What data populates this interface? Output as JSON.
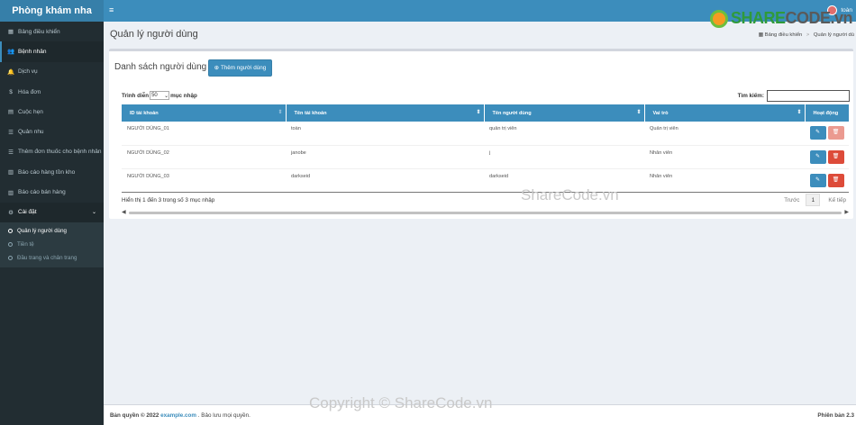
{
  "app": {
    "title": "Phòng khám nha"
  },
  "header": {
    "menu_icon": "hamburger-icon",
    "user_name": "toàn"
  },
  "sidebar": {
    "items": [
      {
        "label": "Bảng điều khiển",
        "icon": "dashboard-icon",
        "glyph": "▦"
      },
      {
        "label": "Bệnh nhân",
        "icon": "users-icon",
        "glyph": "👥"
      },
      {
        "label": "Dịch vụ",
        "icon": "bell-icon",
        "glyph": "🔔"
      },
      {
        "label": "Hóa đơn",
        "icon": "dollar-icon",
        "glyph": "$"
      },
      {
        "label": "Cuộc hẹn",
        "icon": "calendar-icon",
        "glyph": "▤"
      },
      {
        "label": "Quản nhu",
        "icon": "list-icon",
        "glyph": "☰"
      },
      {
        "label": "Thêm đơn thuốc cho bệnh nhân",
        "icon": "list-icon",
        "glyph": "☰"
      },
      {
        "label": "Báo cáo hàng tồn kho",
        "icon": "bar-chart-icon",
        "glyph": "▥"
      },
      {
        "label": "Báo cáo bán hàng",
        "icon": "bar-chart-icon",
        "glyph": "▥"
      }
    ],
    "settings": {
      "label": "Cài đặt",
      "icon": "gear-icon",
      "glyph": "⚙"
    },
    "subitems": [
      {
        "label": "Quản lý người dùng"
      },
      {
        "label": "Tiền tệ"
      },
      {
        "label": "Đầu trang và chân trang"
      }
    ]
  },
  "page": {
    "title": "Quản lý người dùng"
  },
  "breadcrumb": {
    "home": "Bảng điều khiển",
    "current": "Quản lý người dù"
  },
  "box": {
    "title": "Danh sách người dùng",
    "add_button": "Thêm người dùng"
  },
  "table_controls": {
    "show_label": "Trình diễn",
    "entries_value": "50",
    "entries_label": "mục nhập",
    "search_label": "Tìm kiếm:"
  },
  "table": {
    "columns": [
      "ID tài khoản",
      "Tên tài khoản",
      "Tên người dùng",
      "Vai trò",
      "Hoạt động"
    ],
    "rows": [
      [
        "NGƯỜI DÙNG_01",
        "toàn",
        "quản trị viên",
        "Quản trị viên"
      ],
      [
        "NGƯỜI DÙNG_02",
        "janobe",
        "j",
        "Nhân viên"
      ],
      [
        "NGƯỜI DÙNG_03",
        "darkseid",
        "darkseid",
        "Nhân viên"
      ]
    ]
  },
  "pagination": {
    "info": "Hiển thị 1 đến 3 trong số 3 mục nhập",
    "prev": "Trước",
    "page": "1",
    "next": "Kế tiếp"
  },
  "footer": {
    "copyright_prefix": "Bản quyền © 2022",
    "link": "example.com",
    "suffix": ". Bảo lưu mọi quyền.",
    "version": "Phiên bản 2.3"
  },
  "watermarks": {
    "logo_text_green": "SHARE",
    "logo_text_gray": "CODE.vn",
    "middle": "ShareCode.vn",
    "bottom": "Copyright © ShareCode.vn"
  }
}
